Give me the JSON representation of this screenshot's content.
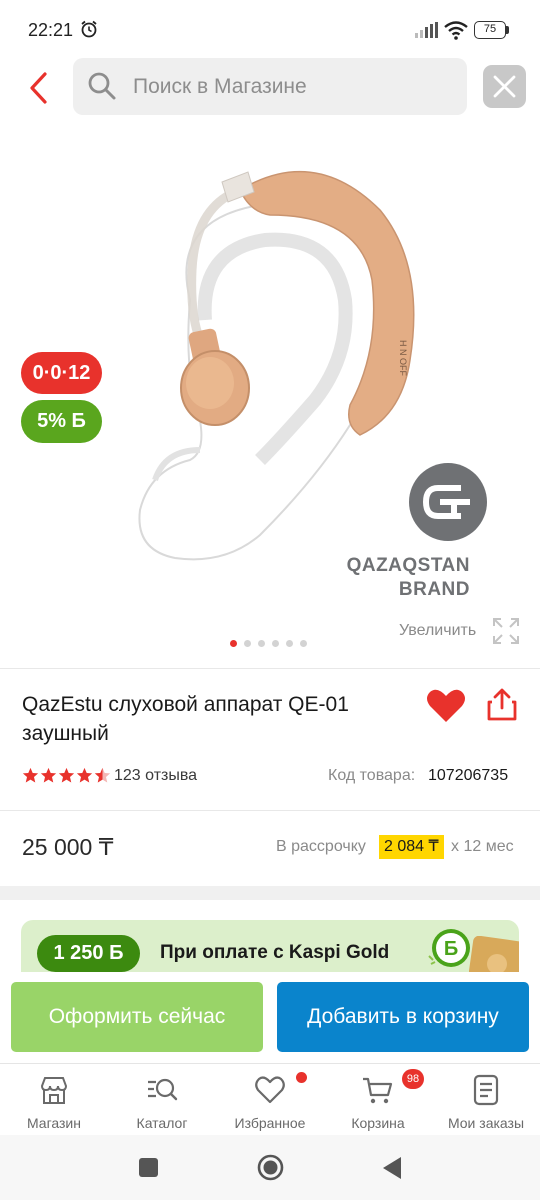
{
  "status_bar": {
    "time": "22:21",
    "battery": "75",
    "icons": [
      "alarm-icon",
      "signal-icon",
      "wifi-icon",
      "battery-icon"
    ]
  },
  "header": {
    "search_placeholder": "Поиск в Магазине",
    "icons": [
      "back-arrow-icon",
      "search-icon",
      "close-icon"
    ],
    "accent_color": "#e8322c"
  },
  "gallery": {
    "timer_badge": "0·0·12",
    "bonus_badge": "5% Б",
    "brand_name": "QAZAQSTAN BRAND",
    "zoom_label": "Увеличить",
    "image_count": 6,
    "active_image": 1
  },
  "product": {
    "title": "QazEstu слуховой аппарат QE-01 заушный",
    "rating": 4.5,
    "reviews": "123 отзыва",
    "code_label": "Код товара:",
    "code_value": "107206735",
    "price": "25 000 ₸",
    "installment_label": "В рассрочку",
    "installment_amount": "2 084 ₸",
    "installment_term": "х 12 мес"
  },
  "promo": {
    "bonus": "1 250 Б",
    "text": "При оплате с Kaspi Gold",
    "color": "#3c8a0f"
  },
  "actions": {
    "buy_now": "Оформить сейчас",
    "add_to_cart": "Добавить в корзину",
    "buy_color": "#99d468",
    "cart_color": "#0a84cc"
  },
  "bottom_nav": {
    "items": [
      {
        "label": "Магазин",
        "icon": "shop-icon"
      },
      {
        "label": "Каталог",
        "icon": "catalog-icon"
      },
      {
        "label": "Избранное",
        "icon": "favorites-icon"
      },
      {
        "label": "Корзина",
        "icon": "cart-icon"
      },
      {
        "label": "Мои заказы",
        "icon": "orders-icon"
      }
    ],
    "cart_count": "98"
  }
}
